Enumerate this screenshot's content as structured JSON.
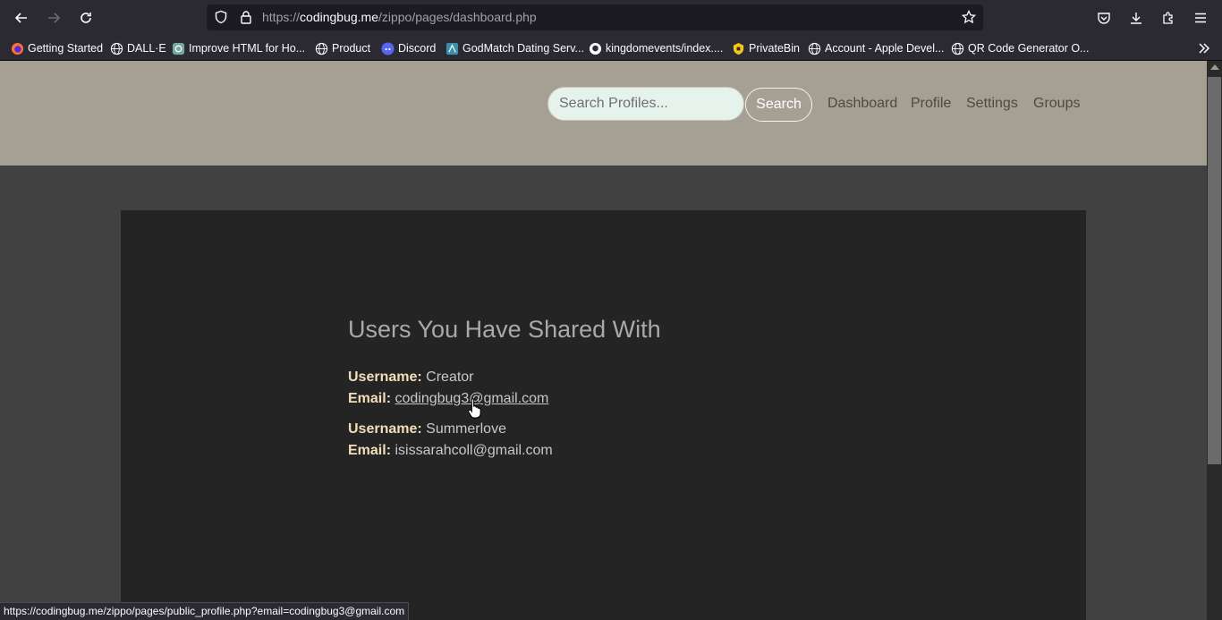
{
  "browser": {
    "url_prefix": "https://",
    "url_host": "codingbug.me",
    "url_path": "/zippo/pages/dashboard.php",
    "bookmarks": [
      {
        "label": "Getting Started",
        "icon": "firefox-icon"
      },
      {
        "label": "DALL·E",
        "icon": "globe-icon"
      },
      {
        "label": "Improve HTML for Ho...",
        "icon": "openai-icon"
      },
      {
        "label": "Product",
        "icon": "globe-icon"
      },
      {
        "label": "Discord",
        "icon": "discord-icon"
      },
      {
        "label": "GodMatch Dating Serv...",
        "icon": "site-icon"
      },
      {
        "label": "kingdomevents/index....",
        "icon": "github-icon"
      },
      {
        "label": "PrivateBin",
        "icon": "privatebin-icon"
      },
      {
        "label": "Account - Apple Devel...",
        "icon": "globe-icon"
      },
      {
        "label": "QR Code Generator O...",
        "icon": "globe-icon"
      }
    ],
    "status_url": "https://codingbug.me/zippo/pages/public_profile.php?email=codingbug3@gmail.com"
  },
  "header": {
    "search_placeholder": "Search Profiles...",
    "search_button": "Search",
    "nav": [
      "Dashboard",
      "Profile",
      "Settings",
      "Groups"
    ]
  },
  "main": {
    "heading": "Users You Have Shared With",
    "username_label": "Username:",
    "email_label": "Email:",
    "users": [
      {
        "username": "Creator",
        "email": "codingbug3@gmail.com"
      },
      {
        "username": "Summerlove",
        "email": "isissarahcoll@gmail.com"
      }
    ]
  }
}
